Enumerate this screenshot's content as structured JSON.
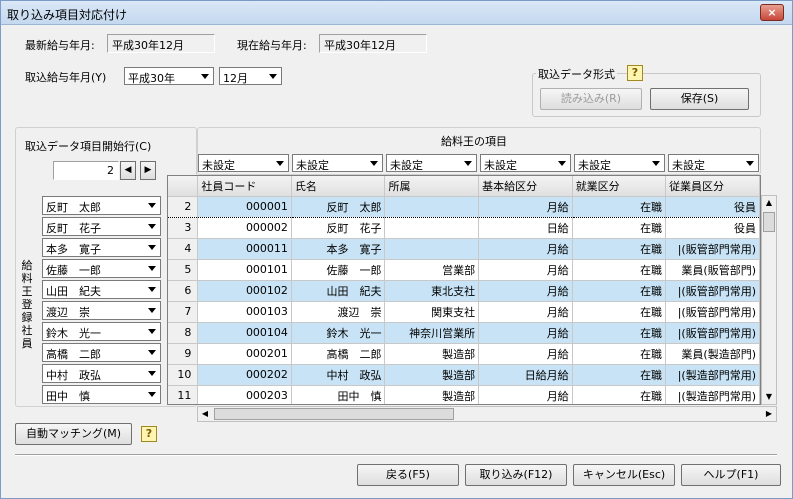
{
  "window": {
    "title": "取り込み項目対応付け",
    "close": "×"
  },
  "info": {
    "latest_label": "最新給与年月:",
    "latest_value": "平成30年12月",
    "current_label": "現在給与年月:",
    "current_value": "平成30年12月"
  },
  "import_month": {
    "label": "取込給与年月(Y)",
    "year": "平成30年",
    "month": "12月"
  },
  "format": {
    "label": "取込データ形式",
    "load_button": "読み込み(R)",
    "save_button": "保存(S)"
  },
  "start_row": {
    "label": "取込データ項目開始行(C)",
    "value": "2"
  },
  "mapping": {
    "header": "給料王の項目",
    "columns": [
      "未設定",
      "未設定",
      "未設定",
      "未設定",
      "未設定",
      "未設定"
    ]
  },
  "grid": {
    "headers": [
      "社員コード",
      "氏名",
      "所属",
      "基本給区分",
      "就業区分",
      "従業員区分"
    ],
    "rows": [
      {
        "no": "2",
        "code": "000001",
        "name": "反町　太郎",
        "dept": "",
        "pay": "月給",
        "status": "在職",
        "type": "役員"
      },
      {
        "no": "3",
        "code": "000002",
        "name": "反町　花子",
        "dept": "",
        "pay": "日給",
        "status": "在職",
        "type": "役員"
      },
      {
        "no": "4",
        "code": "000011",
        "name": "本多　寛子",
        "dept": "",
        "pay": "月給",
        "status": "在職",
        "type": "|(販管部門常用)"
      },
      {
        "no": "5",
        "code": "000101",
        "name": "佐藤　一郎",
        "dept": "営業部",
        "pay": "月給",
        "status": "在職",
        "type": "業員(販管部門)"
      },
      {
        "no": "6",
        "code": "000102",
        "name": "山田　紀夫",
        "dept": "東北支社",
        "pay": "月給",
        "status": "在職",
        "type": "|(販管部門常用)"
      },
      {
        "no": "7",
        "code": "000103",
        "name": "渡辺　崇",
        "dept": "関東支社",
        "pay": "月給",
        "status": "在職",
        "type": "|(販管部門常用)"
      },
      {
        "no": "8",
        "code": "000104",
        "name": "鈴木　光一",
        "dept": "神奈川営業所",
        "pay": "月給",
        "status": "在職",
        "type": "|(販管部門常用)"
      },
      {
        "no": "9",
        "code": "000201",
        "name": "高橋　二郎",
        "dept": "製造部",
        "pay": "月給",
        "status": "在職",
        "type": "業員(製造部門)"
      },
      {
        "no": "10",
        "code": "000202",
        "name": "中村　政弘",
        "dept": "製造部",
        "pay": "日給月給",
        "status": "在職",
        "type": "|(製造部門常用)"
      },
      {
        "no": "11",
        "code": "000203",
        "name": "田中　慎",
        "dept": "製造部",
        "pay": "月給",
        "status": "在職",
        "type": "|(製造部門常用)"
      }
    ]
  },
  "employees": {
    "label": "給料王登録社員",
    "list": [
      "反町　太郎",
      "反町　花子",
      "本多　寛子",
      "佐藤　一郎",
      "山田　紀夫",
      "渡辺　崇",
      "鈴木　光一",
      "高橋　二郎",
      "中村　政弘",
      "田中　慎"
    ]
  },
  "automatch_button": "自動マッチング(M)",
  "footer": {
    "back": "戻る(F5)",
    "import": "取り込み(F12)",
    "cancel": "キャンセル(Esc)",
    "help": "ヘルプ(F1)"
  },
  "help_icon_glyph": "?"
}
